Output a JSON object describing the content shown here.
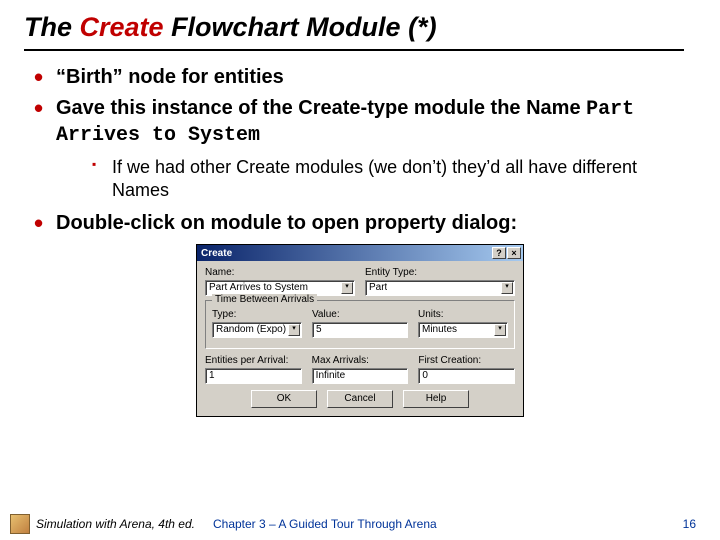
{
  "title": {
    "pre": "The ",
    "red": "Create",
    "post": " Flowchart Module (*)"
  },
  "bullets": {
    "b1": "“Birth” node for entities",
    "b2_a": "Gave this instance of the Create-type module the Name ",
    "b2_mono": "Part Arrives to System",
    "b2_sub": "If we had other Create modules (we don’t) they’d all have different Names",
    "b3": "Double-click on module to open property dialog:"
  },
  "dialog": {
    "title": "Create",
    "help": "?",
    "close": "×",
    "labels": {
      "name": "Name:",
      "entity_type": "Entity Type:",
      "tba": "Time Between Arrivals",
      "type": "Type:",
      "value": "Value:",
      "units": "Units:",
      "epa": "Entities per Arrival:",
      "max": "Max Arrivals:",
      "first": "First Creation:"
    },
    "values": {
      "name": "Part Arrives to System",
      "entity_type": "Part",
      "type": "Random (Expo)",
      "value": "5",
      "units": "Minutes",
      "epa": "1",
      "max": "Infinite",
      "first": "0"
    },
    "buttons": {
      "ok": "OK",
      "cancel": "Cancel",
      "help": "Help"
    },
    "chevron": "▾"
  },
  "footer": {
    "left": "Simulation with Arena, 4th ed.",
    "mid": "Chapter 3 – A Guided Tour Through Arena",
    "page": "16"
  }
}
